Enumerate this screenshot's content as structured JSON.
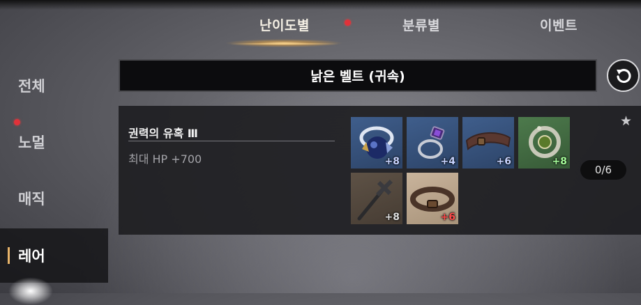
{
  "tabs": [
    {
      "label": "난이도별",
      "active": true,
      "badge": true
    },
    {
      "label": "분류별",
      "active": false,
      "badge": false
    },
    {
      "label": "이벤트",
      "active": false,
      "badge": false
    }
  ],
  "sidebar": {
    "items": [
      {
        "label": "전체",
        "active": false,
        "badge": false
      },
      {
        "label": "노멀",
        "active": false,
        "badge": true
      },
      {
        "label": "매직",
        "active": false,
        "badge": false
      },
      {
        "label": "레어",
        "active": true,
        "badge": false
      }
    ]
  },
  "collection": {
    "title": "낡은 벨트 (귀속)",
    "refresh_icon": "refresh-icon"
  },
  "set": {
    "name": "권력의 유혹 Ⅲ",
    "effect": "최대 HP +700",
    "progress": "0/6",
    "favorite_icon": "star-icon",
    "items": [
      {
        "icon": "necklace-icon",
        "level": "+8",
        "grade_color": "#3f5e8c",
        "level_color": "#c8d4ff"
      },
      {
        "icon": "ring-icon",
        "level": "+4",
        "grade_color": "#3f5e8c",
        "level_color": "#c8d4ff"
      },
      {
        "icon": "belt-icon",
        "level": "+6",
        "grade_color": "#3f5e8c",
        "level_color": "#c8d4ff"
      },
      {
        "icon": "earring-icon",
        "level": "+8",
        "grade_color": "#4d7a4c",
        "level_color": "#a6ff9a"
      },
      {
        "icon": "cross-staff-icon",
        "level": "+8",
        "grade_color": "#5e5246",
        "level_color": "#e0e0e0"
      },
      {
        "icon": "belt-icon",
        "level": "+6",
        "grade_color": "#c9b49c",
        "level_color": "#ff4a4a"
      }
    ]
  },
  "colors": {
    "accent": "#f3cc86",
    "badge": "#e0323a"
  }
}
